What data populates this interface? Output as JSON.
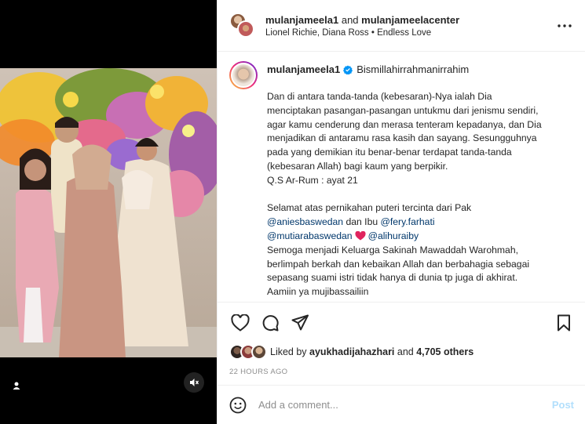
{
  "post": {
    "author": "mulanjameela1",
    "coauthor_joiner": "and",
    "coauthor": "mulanjameelacenter",
    "music": "Lionel Richie, Diana Ross • Endless Love"
  },
  "caption": {
    "username": "mulanjameela1",
    "first_line": "Bismillahirrahmanirrahim",
    "lines": [
      "Dan di antara tanda-tanda (kebesaran)-Nya ialah Dia",
      "menciptakan pasangan-pasangan untukmu dari jenismu sendiri,",
      "agar kamu cenderung dan merasa tenteram kepadanya, dan Dia",
      "menjadikan di antaramu rasa kasih dan sayang. Sesungguhnya",
      "pada yang demikian itu benar-benar terdapat tanda-tanda",
      "(kebesaran Allah) bagi kaum yang berpikir.",
      "Q.S Ar-Rum : ayat 21"
    ],
    "congrats_line": "Selamat atas pernikahan puteri tercinta dari Pak",
    "mention_1": "@aniesbaswedan",
    "and_ibu": " dan Ibu ",
    "mention_2": "@fery.farhati",
    "mention_3": "@mutiarabaswedan",
    "mention_4": "@alihuraiby",
    "closing_lines": [
      "Semoga menjadi Keluarga Sakinah Mawaddah Warohmah,",
      "berlimpah berkah dan kebaikan Allah dan berbahagia sebagai",
      "sepasang suami istri tidak hanya di dunia tp juga di akhirat.",
      "Aamiin ya mujibassailiin"
    ]
  },
  "likes": {
    "prefix": "Liked by ",
    "user": "ayukhadijahazhari",
    "joiner": " and ",
    "others": "4,705 others"
  },
  "timestamp": "22 HOURS AGO",
  "comment": {
    "placeholder": "Add a comment...",
    "post_label": "Post"
  },
  "icons": {
    "more": "more-horizontal-icon",
    "like": "heart-icon",
    "comment": "comment-icon",
    "share": "share-icon",
    "save": "bookmark-icon",
    "emoji": "emoji-icon",
    "tag": "user-tag-icon",
    "mute": "sound-off-icon",
    "verified": "verified-badge-icon"
  },
  "colors": {
    "link": "#00376b",
    "verified": "#0095f6",
    "post_button": "#b2dffc",
    "heart_emoji": "#e0245e",
    "muted_text": "#8e8e8e"
  }
}
